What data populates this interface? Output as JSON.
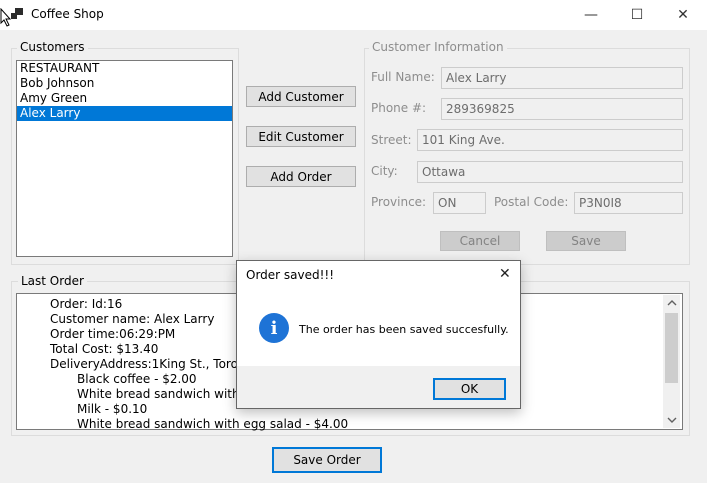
{
  "window": {
    "title": "Coffee Shop",
    "minimize_glyph": "—",
    "maximize_glyph": "☐",
    "close_glyph": "✕"
  },
  "customers": {
    "group_label": "Customers",
    "items": [
      "RESTAURANT",
      "Bob Johnson",
      "Amy Green",
      "Alex Larry"
    ],
    "selected": "Alex Larry"
  },
  "actions": {
    "add_customer": "Add Customer",
    "edit_customer": "Edit Customer",
    "add_order": "Add Order"
  },
  "customer_info": {
    "group_label": "Customer Information",
    "full_name_label": "Full Name:",
    "full_name": "Alex Larry",
    "phone_label": "Phone #:",
    "phone": "289369825",
    "street_label": "Street:",
    "street": "101 King Ave.",
    "city_label": "City:",
    "city": "Ottawa",
    "province_label": "Province:",
    "province": "ON",
    "postal_label": "Postal Code:",
    "postal": "P3N0I8",
    "cancel_label": "Cancel",
    "save_label": "Save"
  },
  "last_order": {
    "group_label": "Last Order",
    "lines": [
      "Order: Id:16",
      "Customer name: Alex Larry",
      "Order time:06:29:PM",
      "Total Cost: $13.40",
      "DeliveryAddress:1King St., Toronto,",
      "Black coffee - $2.00",
      "White bread sandwich with roa",
      "Milk - $0.10",
      "White bread sandwich with egg salad  - $4.00"
    ]
  },
  "save_order_label": "Save Order",
  "dialog": {
    "title": "Order saved!!!",
    "message": "The order has been saved succesfully.",
    "ok_label": "OK",
    "icon_glyph": "i",
    "close_glyph": "✕"
  },
  "colors": {
    "accent": "#0078d7",
    "info_icon": "#1e73d6"
  }
}
